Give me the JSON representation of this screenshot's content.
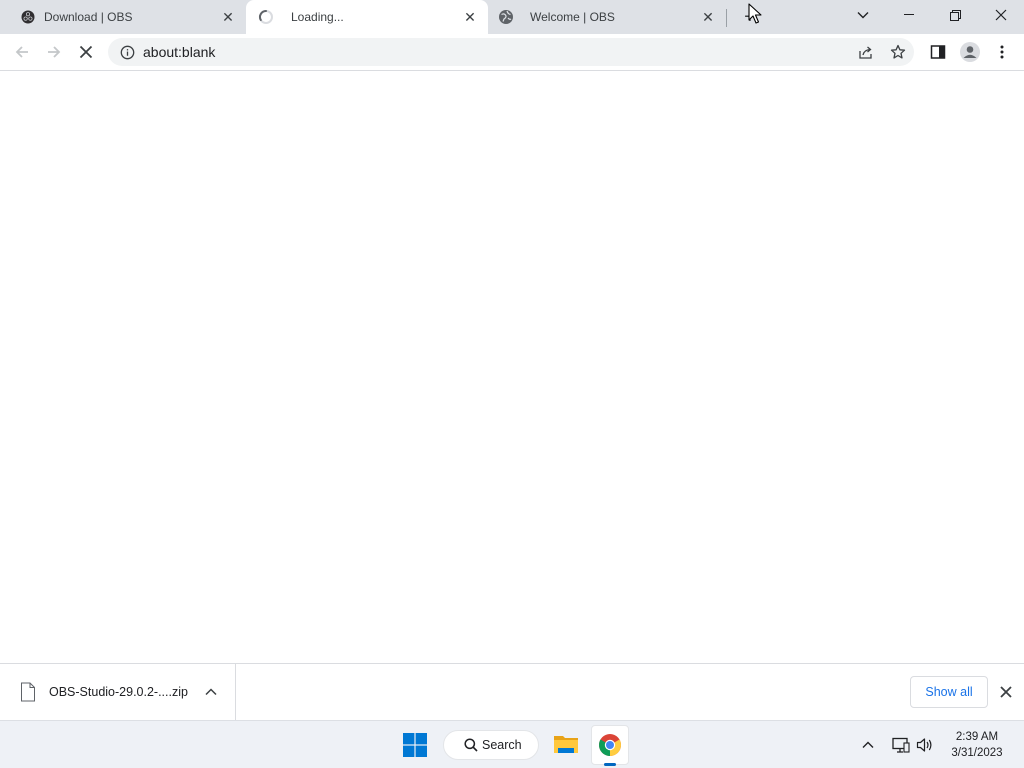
{
  "tabs": [
    {
      "title": "Download | OBS",
      "icon": "obs-icon"
    },
    {
      "title": "Loading...",
      "icon": "loading-spinner-icon",
      "active": true
    },
    {
      "title": "Welcome | OBS",
      "icon": "globe-icon"
    }
  ],
  "new_tab_label": "+",
  "toolbar": {
    "url": "about:blank"
  },
  "download_shelf": {
    "file_name": "OBS-Studio-29.0.2-....zip",
    "show_all_label": "Show all"
  },
  "taskbar": {
    "search_label": "Search",
    "time": "2:39 AM",
    "date": "3/31/2023"
  },
  "colors": {
    "tabstrip_bg": "#dee1e6",
    "link_blue": "#1a73e8",
    "taskbar_bg": "#eef1f6",
    "windows_blue": "#0078d4"
  }
}
